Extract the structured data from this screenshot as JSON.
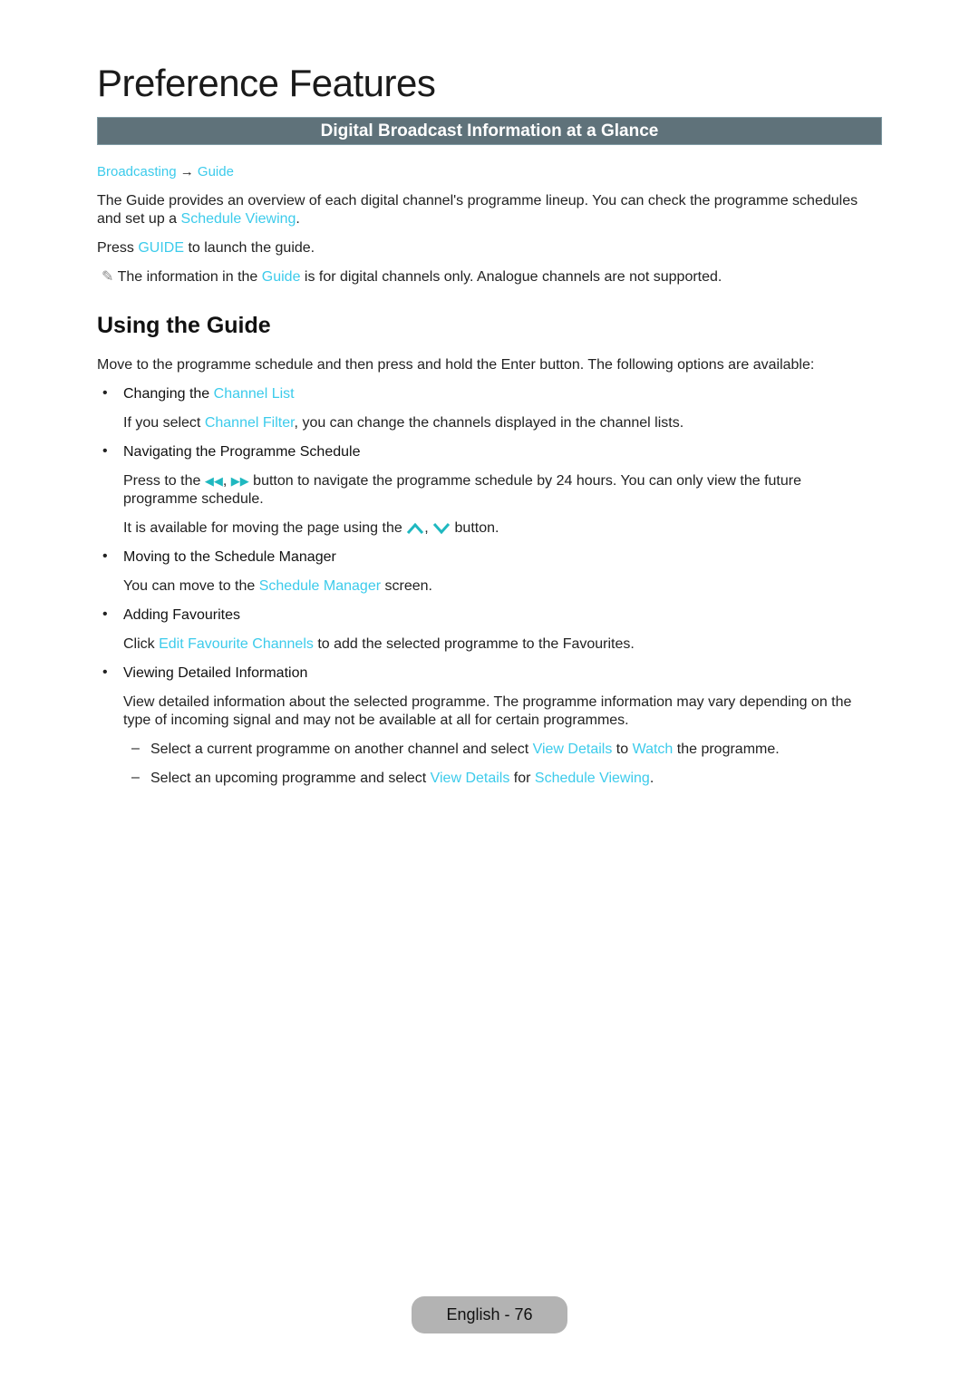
{
  "page_title": "Preference Features",
  "section_header": "Digital Broadcast Information at a Glance",
  "breadcrumb": {
    "part1": "Broadcasting",
    "arrow": "→",
    "part2": "Guide"
  },
  "intro": {
    "p1_a": "The Guide provides an overview of each digital channel's programme lineup. You can check the programme schedules",
    "p1_b": "and set up a ",
    "p1_link": "Schedule Viewing",
    "p1_end": ".",
    "p2_a": "Press ",
    "p2_link": "GUIDE",
    "p2_b": " to launch the guide.",
    "note_icon": "✎",
    "note_a": " The information in the ",
    "note_link": "Guide",
    "note_b": " is for digital channels only. Analogue channels are not supported."
  },
  "using_guide": {
    "heading": "Using the Guide",
    "intro": "Move to the programme schedule and then press and hold the Enter button. The following options are available:",
    "bullet_char": "•",
    "items": [
      {
        "title_a": "Changing the ",
        "title_link": "Channel List",
        "desc_a": "If you select ",
        "desc_link": "Channel Filter",
        "desc_b": ", you can change the channels displayed in the channel lists."
      },
      {
        "title": "Navigating the Programme Schedule",
        "desc1_a": "Press to the ",
        "rew_icon": "◀◀",
        "sep": ", ",
        "ff_icon": "▶▶",
        "desc1_b": " button to navigate the programme schedule by 24 hours. You can only view the future",
        "desc1_c": "programme schedule.",
        "desc2_a": "It is available for moving the page using the ",
        "desc2_b": " button."
      },
      {
        "title": "Moving to the Schedule Manager",
        "desc_a": "You can move to the ",
        "desc_link": "Schedule Manager",
        "desc_b": " screen."
      },
      {
        "title": "Adding Favourites",
        "desc_a": "Click ",
        "desc_link": "Edit Favourite Channels",
        "desc_b": " to add the selected programme to the Favourites."
      },
      {
        "title": "Viewing Detailed Information",
        "desc1": "View detailed information about the selected programme. The programme information may vary depending on the",
        "desc2": "type of incoming signal and may not be available at all for certain programmes."
      }
    ],
    "dash_char": "–",
    "subitems": [
      {
        "a": "Select a current programme on another channel and select ",
        "link1": "View Details",
        "b": " to ",
        "link2": "Watch",
        "c": " the programme."
      },
      {
        "a": "Select an upcoming programme and select ",
        "link1": "View Details",
        "b": " for ",
        "link2": "Schedule Viewing",
        "c": "."
      }
    ]
  },
  "footer": {
    "page_label": "English - 76"
  },
  "colors": {
    "link": "#3ccbeb",
    "header_bar": "#5f727a",
    "footer_pill": "#b3b3b3"
  }
}
